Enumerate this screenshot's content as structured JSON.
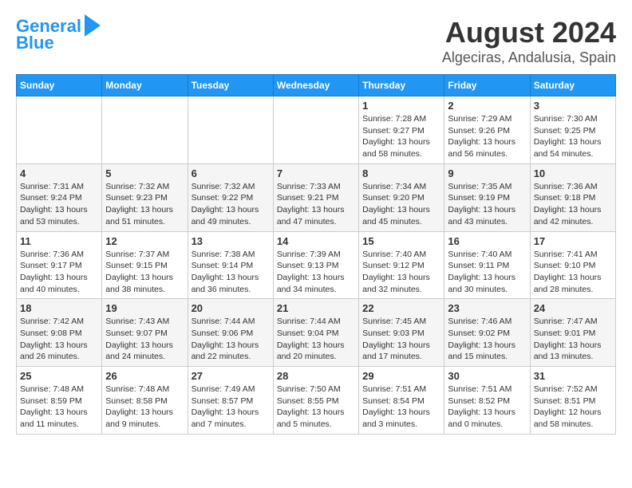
{
  "logo": {
    "line1": "General",
    "line2": "Blue"
  },
  "title": "August 2024",
  "subtitle": "Algeciras, Andalusia, Spain",
  "weekdays": [
    "Sunday",
    "Monday",
    "Tuesday",
    "Wednesday",
    "Thursday",
    "Friday",
    "Saturday"
  ],
  "weeks": [
    [
      {
        "day": "",
        "info": ""
      },
      {
        "day": "",
        "info": ""
      },
      {
        "day": "",
        "info": ""
      },
      {
        "day": "",
        "info": ""
      },
      {
        "day": "1",
        "info": "Sunrise: 7:28 AM\nSunset: 9:27 PM\nDaylight: 13 hours\nand 58 minutes."
      },
      {
        "day": "2",
        "info": "Sunrise: 7:29 AM\nSunset: 9:26 PM\nDaylight: 13 hours\nand 56 minutes."
      },
      {
        "day": "3",
        "info": "Sunrise: 7:30 AM\nSunset: 9:25 PM\nDaylight: 13 hours\nand 54 minutes."
      }
    ],
    [
      {
        "day": "4",
        "info": "Sunrise: 7:31 AM\nSunset: 9:24 PM\nDaylight: 13 hours\nand 53 minutes."
      },
      {
        "day": "5",
        "info": "Sunrise: 7:32 AM\nSunset: 9:23 PM\nDaylight: 13 hours\nand 51 minutes."
      },
      {
        "day": "6",
        "info": "Sunrise: 7:32 AM\nSunset: 9:22 PM\nDaylight: 13 hours\nand 49 minutes."
      },
      {
        "day": "7",
        "info": "Sunrise: 7:33 AM\nSunset: 9:21 PM\nDaylight: 13 hours\nand 47 minutes."
      },
      {
        "day": "8",
        "info": "Sunrise: 7:34 AM\nSunset: 9:20 PM\nDaylight: 13 hours\nand 45 minutes."
      },
      {
        "day": "9",
        "info": "Sunrise: 7:35 AM\nSunset: 9:19 PM\nDaylight: 13 hours\nand 43 minutes."
      },
      {
        "day": "10",
        "info": "Sunrise: 7:36 AM\nSunset: 9:18 PM\nDaylight: 13 hours\nand 42 minutes."
      }
    ],
    [
      {
        "day": "11",
        "info": "Sunrise: 7:36 AM\nSunset: 9:17 PM\nDaylight: 13 hours\nand 40 minutes."
      },
      {
        "day": "12",
        "info": "Sunrise: 7:37 AM\nSunset: 9:15 PM\nDaylight: 13 hours\nand 38 minutes."
      },
      {
        "day": "13",
        "info": "Sunrise: 7:38 AM\nSunset: 9:14 PM\nDaylight: 13 hours\nand 36 minutes."
      },
      {
        "day": "14",
        "info": "Sunrise: 7:39 AM\nSunset: 9:13 PM\nDaylight: 13 hours\nand 34 minutes."
      },
      {
        "day": "15",
        "info": "Sunrise: 7:40 AM\nSunset: 9:12 PM\nDaylight: 13 hours\nand 32 minutes."
      },
      {
        "day": "16",
        "info": "Sunrise: 7:40 AM\nSunset: 9:11 PM\nDaylight: 13 hours\nand 30 minutes."
      },
      {
        "day": "17",
        "info": "Sunrise: 7:41 AM\nSunset: 9:10 PM\nDaylight: 13 hours\nand 28 minutes."
      }
    ],
    [
      {
        "day": "18",
        "info": "Sunrise: 7:42 AM\nSunset: 9:08 PM\nDaylight: 13 hours\nand 26 minutes."
      },
      {
        "day": "19",
        "info": "Sunrise: 7:43 AM\nSunset: 9:07 PM\nDaylight: 13 hours\nand 24 minutes."
      },
      {
        "day": "20",
        "info": "Sunrise: 7:44 AM\nSunset: 9:06 PM\nDaylight: 13 hours\nand 22 minutes."
      },
      {
        "day": "21",
        "info": "Sunrise: 7:44 AM\nSunset: 9:04 PM\nDaylight: 13 hours\nand 20 minutes."
      },
      {
        "day": "22",
        "info": "Sunrise: 7:45 AM\nSunset: 9:03 PM\nDaylight: 13 hours\nand 17 minutes."
      },
      {
        "day": "23",
        "info": "Sunrise: 7:46 AM\nSunset: 9:02 PM\nDaylight: 13 hours\nand 15 minutes."
      },
      {
        "day": "24",
        "info": "Sunrise: 7:47 AM\nSunset: 9:01 PM\nDaylight: 13 hours\nand 13 minutes."
      }
    ],
    [
      {
        "day": "25",
        "info": "Sunrise: 7:48 AM\nSunset: 8:59 PM\nDaylight: 13 hours\nand 11 minutes."
      },
      {
        "day": "26",
        "info": "Sunrise: 7:48 AM\nSunset: 8:58 PM\nDaylight: 13 hours\nand 9 minutes."
      },
      {
        "day": "27",
        "info": "Sunrise: 7:49 AM\nSunset: 8:57 PM\nDaylight: 13 hours\nand 7 minutes."
      },
      {
        "day": "28",
        "info": "Sunrise: 7:50 AM\nSunset: 8:55 PM\nDaylight: 13 hours\nand 5 minutes."
      },
      {
        "day": "29",
        "info": "Sunrise: 7:51 AM\nSunset: 8:54 PM\nDaylight: 13 hours\nand 3 minutes."
      },
      {
        "day": "30",
        "info": "Sunrise: 7:51 AM\nSunset: 8:52 PM\nDaylight: 13 hours\nand 0 minutes."
      },
      {
        "day": "31",
        "info": "Sunrise: 7:52 AM\nSunset: 8:51 PM\nDaylight: 12 hours\nand 58 minutes."
      }
    ]
  ]
}
